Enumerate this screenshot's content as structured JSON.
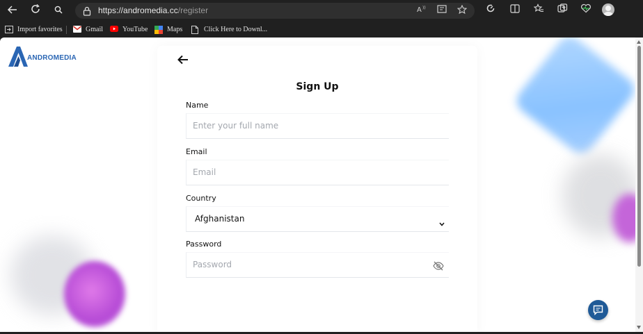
{
  "browser": {
    "url_host": "https://andromedia.cc",
    "url_path": "/register",
    "nav_icons": [
      "back-icon",
      "refresh-icon",
      "search-icon"
    ],
    "toolbar_icons": [
      "read-aloud-icon",
      "immersive-reader-icon",
      "favorite-star-icon",
      "browser-essentials-icon",
      "split-screen-icon",
      "favorites-icon",
      "collections-icon",
      "health-icon",
      "profile-avatar"
    ],
    "favorites": [
      {
        "label": "Import favorites",
        "icon": "import-icon"
      },
      {
        "label": "Gmail",
        "icon": "gmail-icon"
      },
      {
        "label": "YouTube",
        "icon": "youtube-icon"
      },
      {
        "label": "Maps",
        "icon": "maps-icon"
      },
      {
        "label": "Click Here to Downl...",
        "icon": "page-icon"
      }
    ]
  },
  "brand": {
    "name": "ANDROMEDIA",
    "color": "#2a66b4"
  },
  "form": {
    "title": "Sign Up",
    "fields": {
      "name": {
        "label": "Name",
        "placeholder": "Enter your full name"
      },
      "email": {
        "label": "Email",
        "placeholder": "Email"
      },
      "country": {
        "label": "Country",
        "value": "Afghanistan"
      },
      "password": {
        "label": "Password",
        "placeholder": "Password"
      }
    }
  },
  "colors": {
    "accent": "#1f5a97",
    "blob_purple": "#c465d9",
    "blob_blue": "#7dbcff"
  }
}
